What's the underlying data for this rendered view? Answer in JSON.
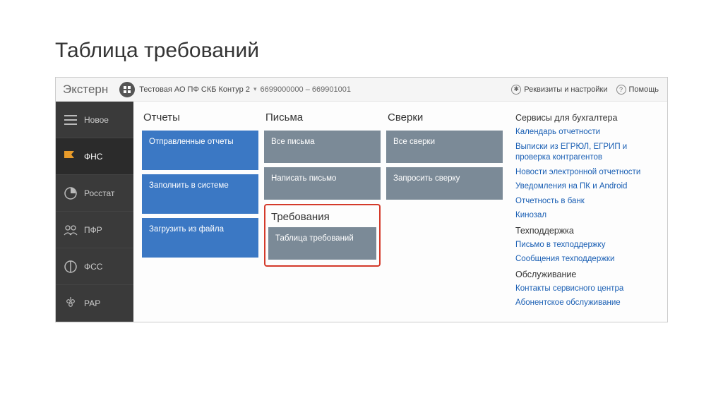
{
  "pageTitle": "Таблица требований",
  "brand": "Экстерн",
  "org": {
    "name": "Тестовая АО ПФ СКБ Контур 2",
    "range": "6699000000 – 669901001"
  },
  "topbar": {
    "settings": "Реквизиты и настройки",
    "help": "Помощь"
  },
  "sidebar": {
    "items": [
      {
        "label": "Новое",
        "icon": "menu"
      },
      {
        "label": "ФНС",
        "icon": "flag",
        "active": true
      },
      {
        "label": "Росстат",
        "icon": "pie"
      },
      {
        "label": "ПФР",
        "icon": "people"
      },
      {
        "label": "ФСС",
        "icon": "circle"
      },
      {
        "label": "РАР",
        "icon": "grapes"
      }
    ]
  },
  "columns": {
    "reports": {
      "header": "Отчеты",
      "tiles": [
        "Отправленные отчеты",
        "Заполнить в системе",
        "Загрузить из файла"
      ]
    },
    "letters": {
      "header": "Письма",
      "tiles": [
        "Все письма",
        "Написать письмо"
      ]
    },
    "requirements": {
      "header": "Требования",
      "tiles": [
        "Таблица требований"
      ]
    },
    "reconciliations": {
      "header": "Сверки",
      "tiles": [
        "Все сверки",
        "Запросить сверку"
      ]
    }
  },
  "rightPanel": {
    "sections": [
      {
        "header": "Сервисы для бухгалтера",
        "links": [
          "Календарь отчетности",
          "Выписки из ЕГРЮЛ, ЕГРИП и проверка контрагентов",
          "Новости электронной отчетности",
          "Уведомления на ПК и Android",
          "Отчетность в банк",
          "Кинозал"
        ]
      },
      {
        "header": "Техподдержка",
        "links": [
          "Письмо в техподдержку",
          "Сообщения техподдержки"
        ]
      },
      {
        "header": "Обслуживание",
        "links": [
          "Контакты сервисного центра",
          "Абонентское обслуживание"
        ]
      }
    ]
  }
}
